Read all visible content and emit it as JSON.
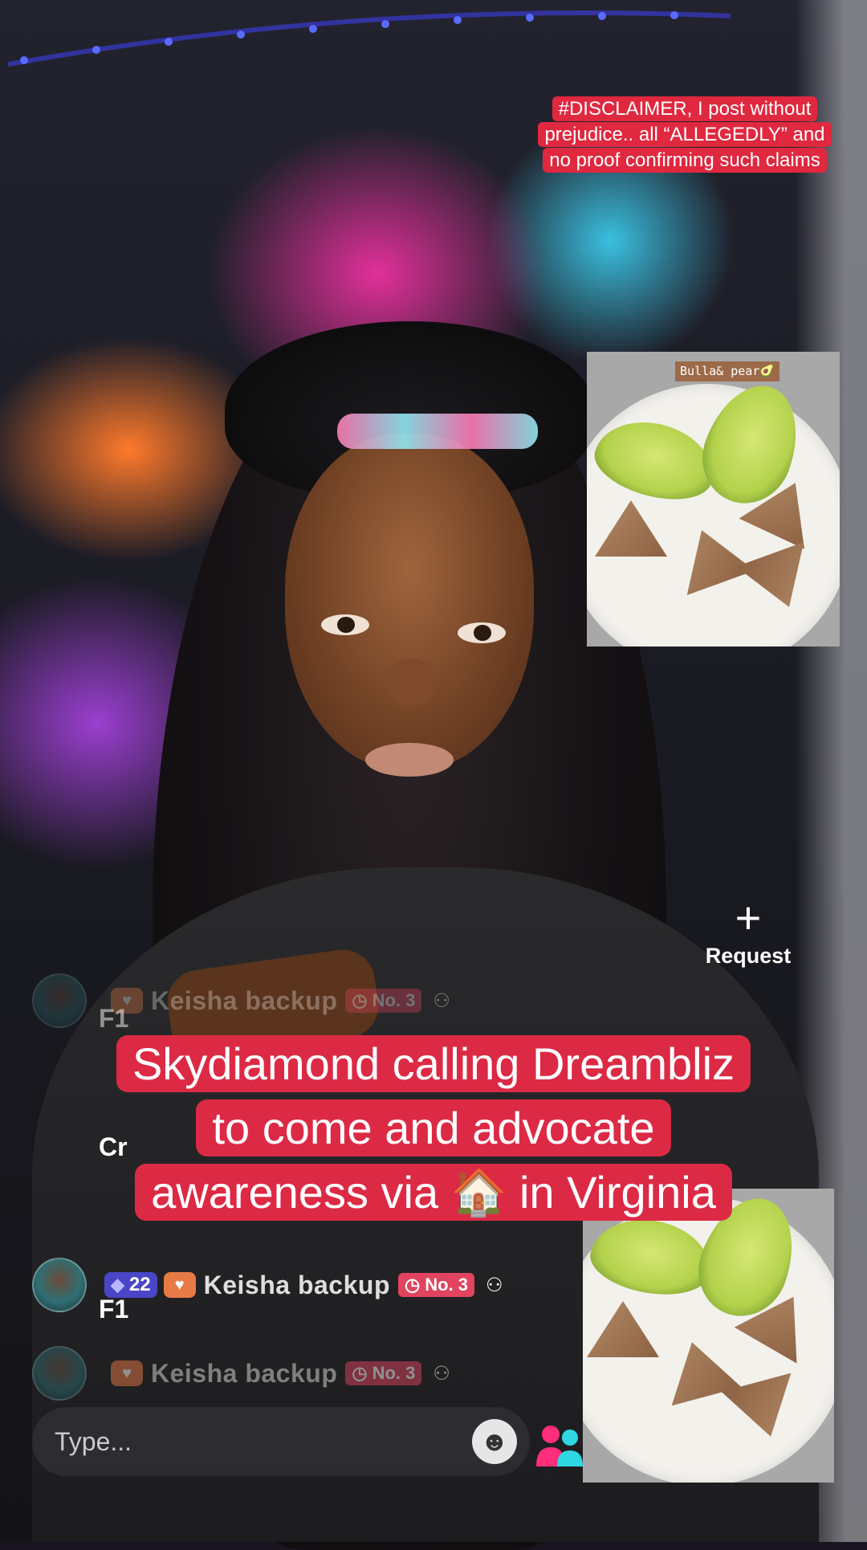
{
  "overlay": {
    "disclaimer": "#DISCLAIMER, I post without prejudice.. all “ALLEGEDLY” and no proof confirming  such claims",
    "food_label": "Bulla& pear🥑"
  },
  "request": {
    "plus": "+",
    "label": "Request"
  },
  "comments": [
    {
      "level": "",
      "username": "Keisha backup",
      "rank": "No. 3",
      "text": "F1"
    },
    {
      "level": "",
      "username": "",
      "rank": "",
      "text": "Cr"
    },
    {
      "level": "22",
      "username": "Keisha backup",
      "rank": "No. 3",
      "text": "F1"
    },
    {
      "level": "",
      "username": "Keisha backup",
      "rank": "No. 3",
      "text": ""
    }
  ],
  "caption": {
    "line1": "Skydiamond calling Dreambliz",
    "line2": "to come and advocate",
    "line3": "awareness via 🏠 in Virginia"
  },
  "input": {
    "placeholder": "Type..."
  },
  "icons": [
    "plus-icon",
    "gem-icon",
    "heart-badge-icon",
    "clock-icon",
    "follow-icon",
    "emoji-icon",
    "people-icon"
  ],
  "colors": {
    "caption_bg": "#dc2a45",
    "disclaimer_bg": "#e0283f",
    "level_badge": "#4a46c8",
    "rank_badge": "#e0445e"
  }
}
